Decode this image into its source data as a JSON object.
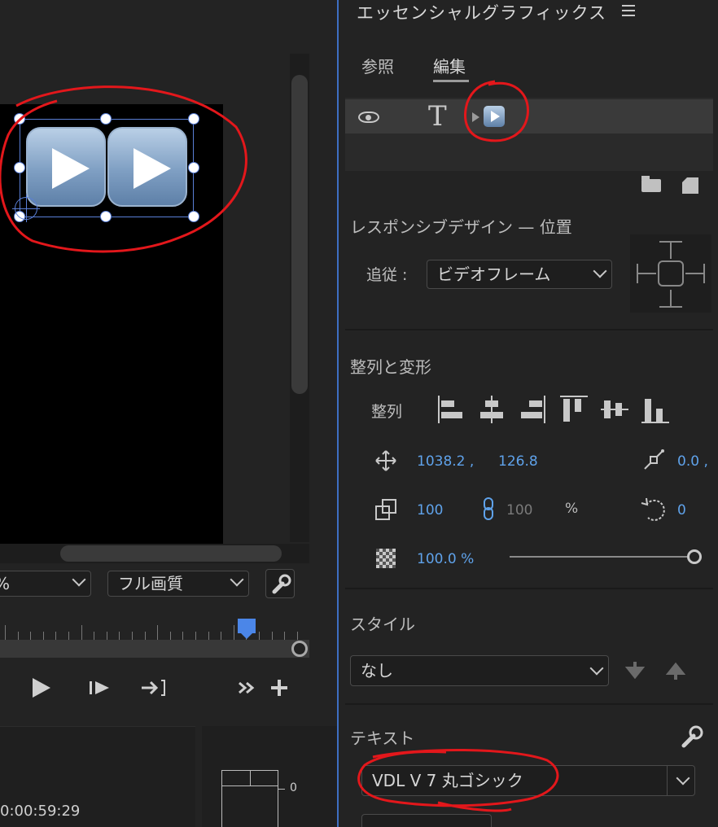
{
  "monitor": {
    "zoom_value": "%",
    "quality_value": "フル画質",
    "timecode": "0:00:59:29",
    "meter_zero": "0"
  },
  "panel": {
    "title": "エッセンシャルグラフィックス",
    "tabs": [
      {
        "label": "参照",
        "active": false
      },
      {
        "label": "編集",
        "active": true
      }
    ],
    "responsive": {
      "title": "レスポンシブデザイン — 位置",
      "follow_label": "追従 :",
      "follow_value": "ビデオフレーム"
    },
    "align_transform": {
      "title": "整列と変形",
      "align_label": "整列",
      "position_x": "1038.2 ,",
      "position_y": "126.8",
      "anchor_x": "0.0 ,",
      "scale": "100",
      "scale_linked": "100",
      "percent": "%",
      "rotation": "0",
      "opacity": "100.0 %",
      "opacity_level": 1.0
    },
    "style": {
      "title": "スタイル",
      "value": "なし"
    },
    "text": {
      "title": "テキスト",
      "font": "VDL V 7 丸ゴシック"
    }
  },
  "colors": {
    "accent_blue": "#5fa2ea",
    "annotation_red": "#e3171b",
    "divider_blue": "#3e6fc2"
  }
}
